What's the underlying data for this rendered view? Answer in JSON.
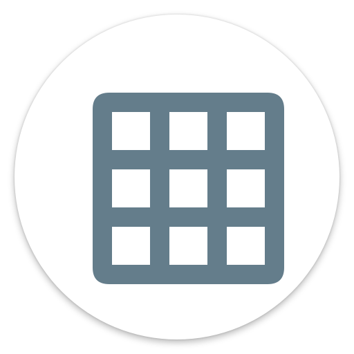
{
  "app_icon": {
    "name": "grid-app-icon",
    "background_color": "#ffffff",
    "glyph": {
      "icon_name": "grid-3x3-icon",
      "color": "#647d8b",
      "rows": 3,
      "columns": 3
    }
  }
}
